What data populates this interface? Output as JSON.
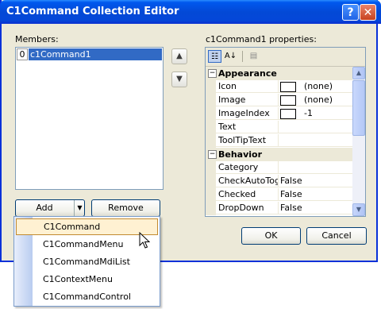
{
  "window": {
    "title": "C1Command Collection Editor",
    "help_glyph": "?",
    "close_glyph": "✕"
  },
  "members": {
    "label": "Members:",
    "items": [
      {
        "index": "0",
        "name": "c1Command1"
      }
    ]
  },
  "properties": {
    "label": "c1Command1 properties:",
    "categories": [
      {
        "name": "Appearance",
        "rows": [
          {
            "name": "Icon",
            "value": "(none)",
            "swatch": true
          },
          {
            "name": "Image",
            "value": "(none)",
            "swatch": true
          },
          {
            "name": "ImageIndex",
            "value": "-1",
            "swatch": true
          },
          {
            "name": "Text",
            "value": ""
          },
          {
            "name": "ToolTipText",
            "value": ""
          }
        ]
      },
      {
        "name": "Behavior",
        "rows": [
          {
            "name": "Category",
            "value": ""
          },
          {
            "name": "CheckAutoToggle",
            "value": "False"
          },
          {
            "name": "Checked",
            "value": "False"
          },
          {
            "name": "DropDown",
            "value": "False"
          }
        ]
      }
    ]
  },
  "buttons": {
    "add": "Add",
    "remove": "Remove",
    "ok": "OK",
    "cancel": "Cancel"
  },
  "add_menu": {
    "items": [
      "C1Command",
      "C1CommandMenu",
      "C1CommandMdiList",
      "C1ContextMenu",
      "C1CommandControl"
    ],
    "highlighted": "C1Command"
  },
  "icons": [
    "help-icon",
    "close-icon",
    "move-up-icon",
    "move-down-icon",
    "categorized-icon",
    "alphabetical-icon",
    "property-pages-icon",
    "dropdown-arrow-icon",
    "cursor-icon"
  ]
}
